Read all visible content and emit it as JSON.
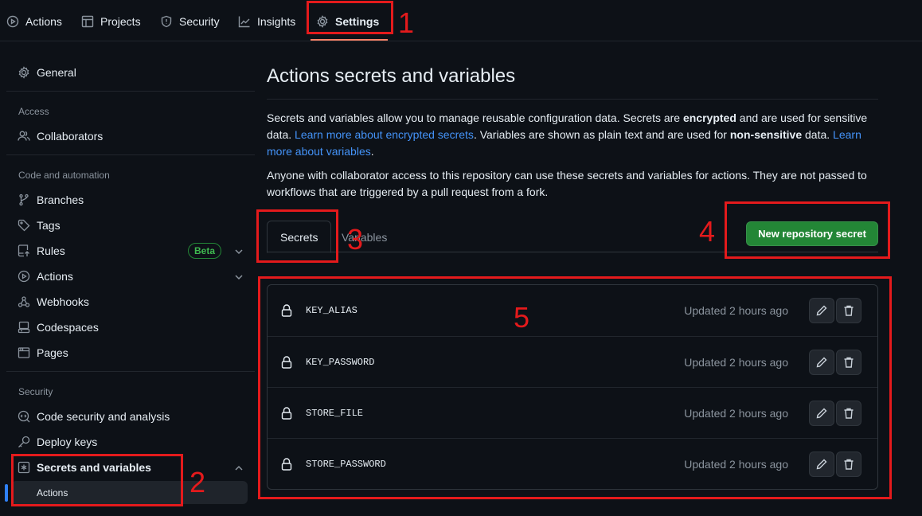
{
  "topnav": {
    "tabs": [
      {
        "label": "Actions",
        "icon": "play-icon"
      },
      {
        "label": "Projects",
        "icon": "table-icon"
      },
      {
        "label": "Security",
        "icon": "shield-icon"
      },
      {
        "label": "Insights",
        "icon": "graph-icon"
      },
      {
        "label": "Settings",
        "icon": "gear-icon",
        "active": true
      }
    ]
  },
  "annotations": [
    "1",
    "2",
    "3",
    "4",
    "5"
  ],
  "sidebar": {
    "general": "General",
    "access_heading": "Access",
    "collaborators": "Collaborators",
    "code_heading": "Code and automation",
    "branches": "Branches",
    "tags": "Tags",
    "rules": "Rules",
    "rules_badge": "Beta",
    "actions": "Actions",
    "webhooks": "Webhooks",
    "codespaces": "Codespaces",
    "pages": "Pages",
    "security_heading": "Security",
    "code_security": "Code security and analysis",
    "deploy_keys": "Deploy keys",
    "secrets_and_variables": "Secrets and variables",
    "secrets_sub_actions": "Actions"
  },
  "main": {
    "title": "Actions secrets and variables",
    "desc": {
      "p1": "Secrets and variables allow you to manage reusable configuration data. Secrets are ",
      "b1": "encrypted",
      "p2": " and are used for sensitive data. ",
      "link1": "Learn more about encrypted secrets",
      "p3": ". Variables are shown as plain text and are used for ",
      "b2": "non-sensitive",
      "p4": " data. ",
      "link2": "Learn more about variables",
      "p5": "."
    },
    "desc2": "Anyone with collaborator access to this repository can use these secrets and variables for actions. They are not passed to workflows that are triggered by a pull request from a fork.",
    "tabs": [
      {
        "label": "Secrets",
        "active": true
      },
      {
        "label": "Variables",
        "active": false
      }
    ],
    "new_button": "New repository secret",
    "secrets": [
      {
        "name": "KEY_ALIAS",
        "updated": "Updated 2 hours ago"
      },
      {
        "name": "KEY_PASSWORD",
        "updated": "Updated 2 hours ago"
      },
      {
        "name": "STORE_FILE",
        "updated": "Updated 2 hours ago"
      },
      {
        "name": "STORE_PASSWORD",
        "updated": "Updated 2 hours ago"
      }
    ]
  },
  "colors": {
    "background": "#0d1117",
    "accent_green": "#238636",
    "link_blue": "#4493f8",
    "annotation_red": "#e41a1c",
    "active_tab_underline": "#f78166"
  }
}
